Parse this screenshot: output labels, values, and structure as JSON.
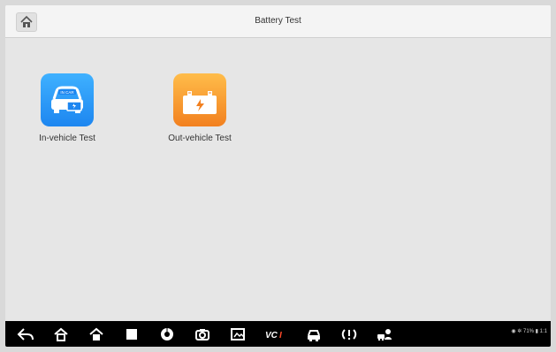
{
  "header": {
    "title": "Battery Test"
  },
  "main": {
    "tiles": [
      {
        "label": "In-vehicle Test",
        "icon": "car-battery-icon",
        "color": "#1d86f0"
      },
      {
        "label": "Out-vehicle Test",
        "icon": "battery-icon",
        "color": "#f2801f"
      }
    ]
  },
  "navbar": {
    "items": [
      {
        "icon": "back-icon"
      },
      {
        "icon": "home-icon"
      },
      {
        "icon": "desktop-home-icon"
      },
      {
        "icon": "recent-apps-icon"
      },
      {
        "icon": "chrome-icon"
      },
      {
        "icon": "camera-icon"
      },
      {
        "icon": "screenshot-icon"
      },
      {
        "icon": "vci-icon",
        "text": "VCI"
      },
      {
        "icon": "car-icon"
      },
      {
        "icon": "tpms-icon"
      },
      {
        "icon": "remote-support-icon"
      }
    ],
    "status_text": "71% ▮ 1:1"
  }
}
